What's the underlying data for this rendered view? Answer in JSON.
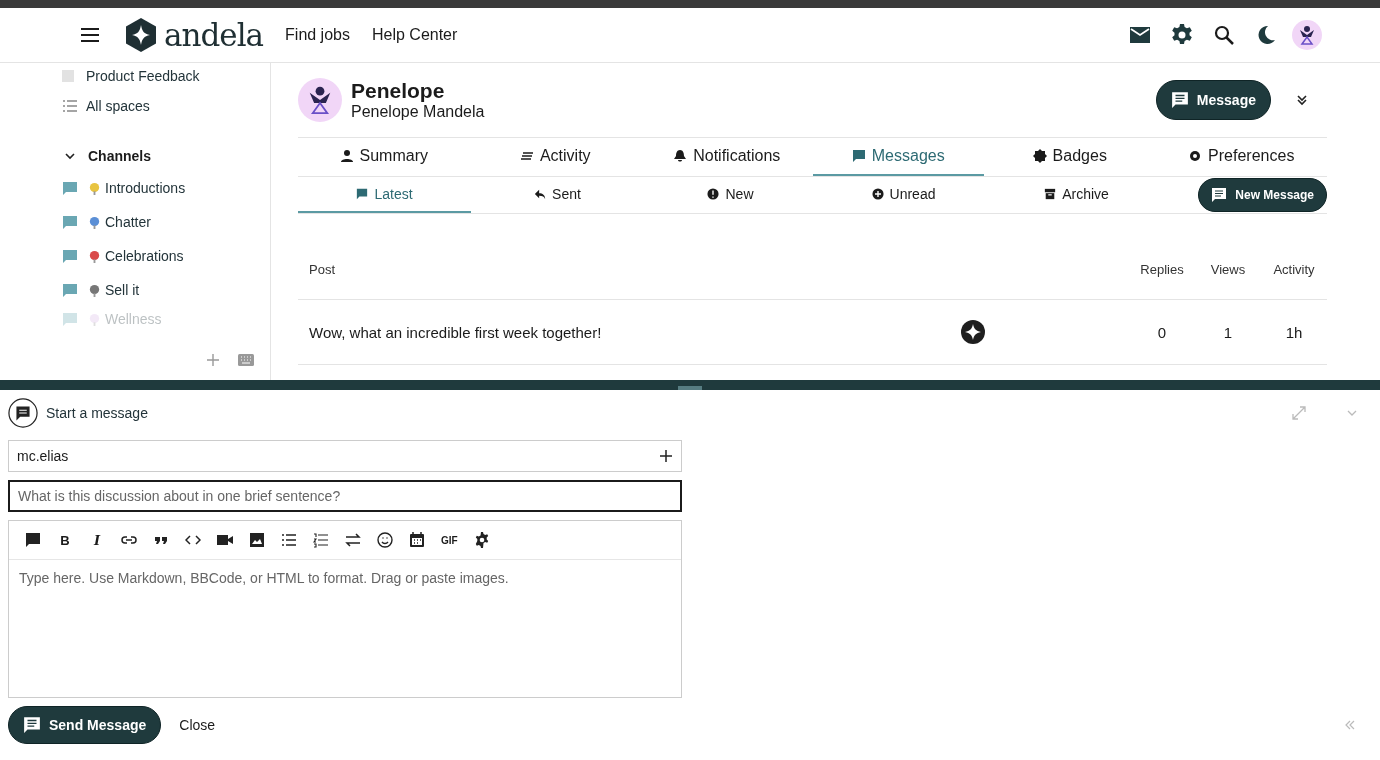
{
  "header": {
    "logo": "andela",
    "nav": [
      "Find jobs",
      "Help Center"
    ]
  },
  "sidebar": {
    "items": [
      {
        "label": "Product Feedback"
      },
      {
        "label": "All spaces"
      }
    ],
    "channels_header": {
      "label": "Channels",
      "expanded": true
    },
    "channels": [
      {
        "label": "Introductions",
        "faded": false
      },
      {
        "label": "Chatter",
        "faded": false
      },
      {
        "label": "Celebrations",
        "faded": false
      },
      {
        "label": "Sell it",
        "faded": false
      },
      {
        "label": "Wellness",
        "faded": true
      }
    ]
  },
  "profile": {
    "name": "Penelope",
    "full_name": "Penelope Mandela",
    "message_button": "Message"
  },
  "tabs": [
    {
      "label": "Summary",
      "selected": false
    },
    {
      "label": "Activity",
      "selected": false
    },
    {
      "label": "Notifications",
      "selected": false
    },
    {
      "label": "Messages",
      "selected": true
    },
    {
      "label": "Badges",
      "selected": false
    },
    {
      "label": "Preferences",
      "selected": false
    }
  ],
  "subtabs": [
    {
      "label": "Latest",
      "selected": true
    },
    {
      "label": "Sent",
      "selected": false
    },
    {
      "label": "New",
      "selected": false
    },
    {
      "label": "Unread",
      "selected": false
    },
    {
      "label": "Archive",
      "selected": false
    }
  ],
  "new_message_button": "New Message",
  "table": {
    "columns": [
      "Post",
      "Replies",
      "Views",
      "Activity"
    ],
    "rows": [
      {
        "title": "Wow, what an incredible first week together!",
        "replies": "0",
        "views": "1",
        "activity": "1h"
      }
    ]
  },
  "composer": {
    "title": "Start a message",
    "recipient": "mc.elias",
    "title_placeholder": "What is this discussion about in one brief sentence?",
    "toolbar": [
      {
        "kind": "icon"
      },
      {
        "kind": "text",
        "label": "B"
      },
      {
        "kind": "italic",
        "label": "I"
      },
      {
        "kind": "icon"
      },
      {
        "kind": "icon"
      },
      {
        "kind": "icon"
      },
      {
        "kind": "icon"
      },
      {
        "kind": "icon"
      },
      {
        "kind": "icon"
      },
      {
        "kind": "icon"
      },
      {
        "kind": "icon"
      },
      {
        "kind": "icon"
      },
      {
        "kind": "icon"
      },
      {
        "kind": "small",
        "label": "GIF"
      },
      {
        "kind": "icon"
      }
    ],
    "body_placeholder": "Type here. Use Markdown, BBCode, or HTML to format. Drag or paste images.",
    "send_button": "Send Message",
    "close": "Close"
  }
}
